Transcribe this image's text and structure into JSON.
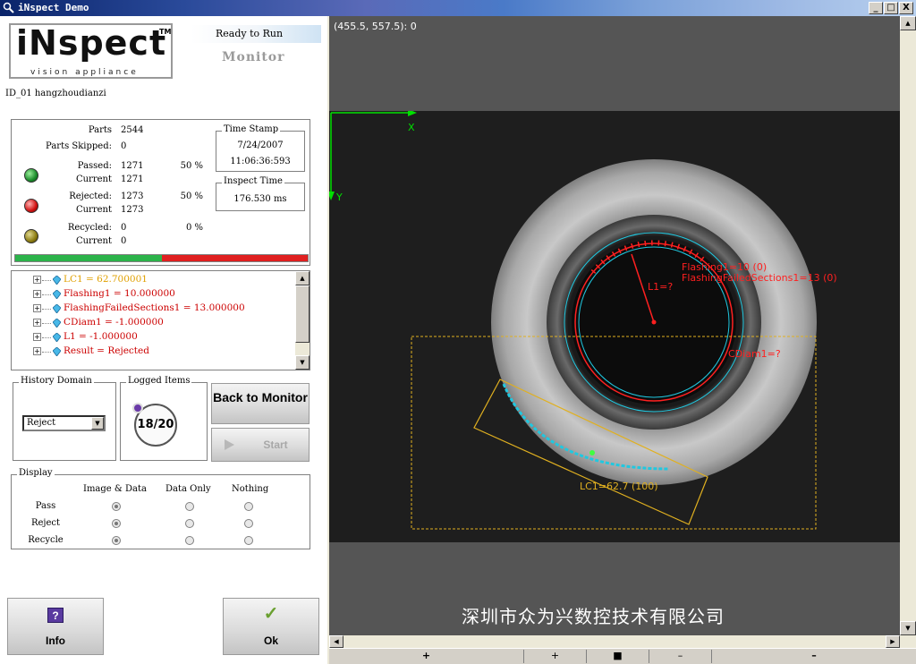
{
  "window": {
    "title": "iNspect Demo",
    "minimize": "_",
    "maximize": "□",
    "close": "X"
  },
  "logo": {
    "main": "iNspect",
    "tm": "TM",
    "sub": "vision appliance"
  },
  "status": {
    "ready": "Ready to Run",
    "mode": "Monitor"
  },
  "job": {
    "id": "ID_01  hangzhoudianzi"
  },
  "stats": {
    "parts_label": "Parts",
    "parts": "2544",
    "skipped_label": "Parts Skipped:",
    "skipped": "0",
    "passed_label": "Passed:",
    "passed": "1271",
    "passed_pct": "50 %",
    "passed_current_label": "Current",
    "passed_current": "1271",
    "rejected_label": "Rejected:",
    "rejected": "1273",
    "rejected_pct": "50 %",
    "rejected_current_label": "Current",
    "rejected_current": "1273",
    "recycled_label": "Recycled:",
    "recycled": "0",
    "recycled_pct": "0 %",
    "recycled_current_label": "Current",
    "recycled_current": "0",
    "pass_fraction": 0.5
  },
  "timestamp": {
    "label": "Time Stamp",
    "date": "7/24/2007",
    "time": "11:06:36:593"
  },
  "inspect_time": {
    "label": "Inspect Time",
    "value": "176.530 ms"
  },
  "results": [
    {
      "text": "LC1 = 62.700001",
      "color": "#e0a000"
    },
    {
      "text": "Flashing1 = 10.000000",
      "color": "#cc0000"
    },
    {
      "text": "FlashingFailedSections1 = 13.000000",
      "color": "#cc0000"
    },
    {
      "text": "CDiam1 = -1.000000",
      "color": "#cc0000"
    },
    {
      "text": "L1 = -1.000000",
      "color": "#cc0000"
    },
    {
      "text": "Result = Rejected",
      "color": "#cc0000"
    }
  ],
  "history": {
    "label": "History Domain",
    "selected": "Reject"
  },
  "logged": {
    "label": "Logged Items",
    "count": "18/20"
  },
  "buttons": {
    "back_to_monitor": "Back to Monitor",
    "start": "Start",
    "info": "Info",
    "ok": "Ok",
    "info_icon": "?",
    "ok_icon": "✓"
  },
  "display": {
    "label": "Display",
    "columns": [
      "Image & Data",
      "Data Only",
      "Nothing"
    ],
    "rows": [
      {
        "label": "Pass",
        "selected": 0
      },
      {
        "label": "Reject",
        "selected": 0
      },
      {
        "label": "Recycle",
        "selected": 0
      }
    ]
  },
  "image_view": {
    "coord": "(455.5, 557.5): 0",
    "axis_x": "X",
    "axis_y": "Y",
    "flashing": "Flashing1=10 (0)",
    "flashing_failed": "FlashingFailedSections1=13 (0)",
    "l1": "L1=?",
    "cdiam": "CDiam1=?",
    "lc1": "LC1=62.7 (100)",
    "watermark": "深圳市众为兴数控技术有限公司"
  },
  "toolbar": {
    "zoom_in": "+",
    "zoom_in_small": "+",
    "stop": "■",
    "zoom_out_small": "–",
    "zoom_out": "–"
  },
  "colors": {
    "pass": "#2bb34a",
    "reject": "#e02020",
    "recycle": "#8a7a10",
    "overlay_red": "#ff2020",
    "overlay_cyan": "#20c8e0",
    "overlay_yellow": "#e0b020",
    "axis_green": "#00e000"
  }
}
